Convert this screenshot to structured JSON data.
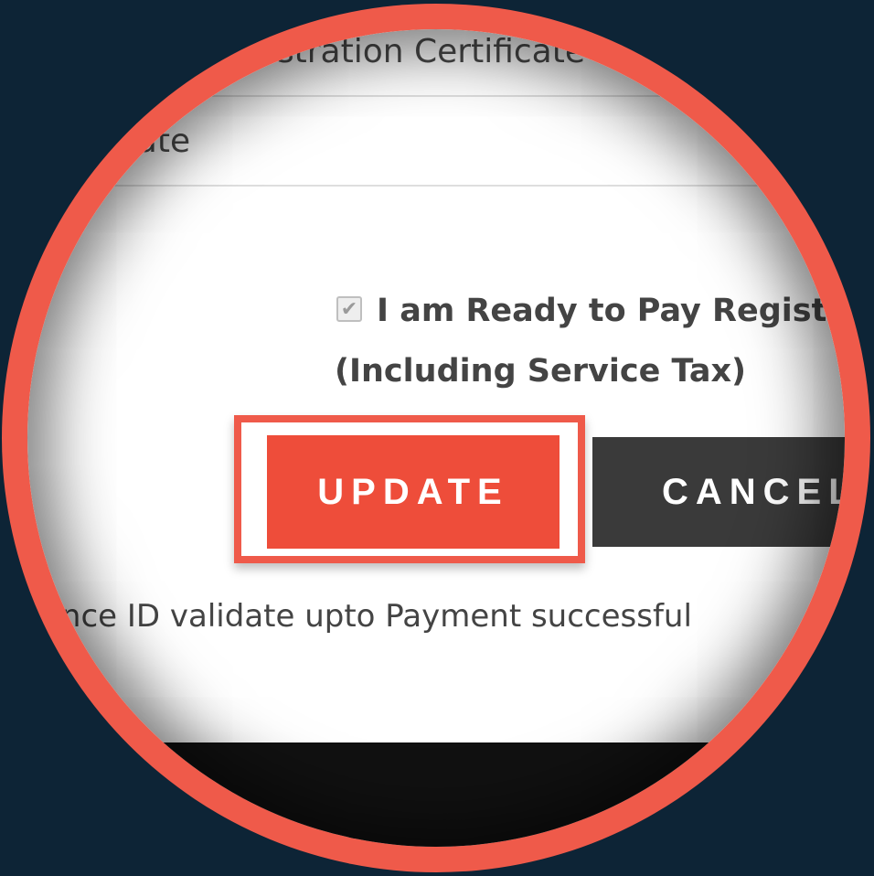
{
  "form": {
    "row1_text": "gistration Certificate",
    "row2_text": "icate"
  },
  "consent": {
    "checked": true,
    "check_glyph": "✔",
    "line1": "I am Ready to Pay Registra",
    "line2": "(Including Service Tax)"
  },
  "actions": {
    "update_label": "UPDATE",
    "cancel_label": "CANCEL"
  },
  "note": {
    "text": "ence ID validate upto Payment successful"
  },
  "colors": {
    "accent": "#ee4d3a",
    "ring": "#ef5a4a",
    "background": "#0d2436",
    "cancel": "#3a3a3a"
  }
}
